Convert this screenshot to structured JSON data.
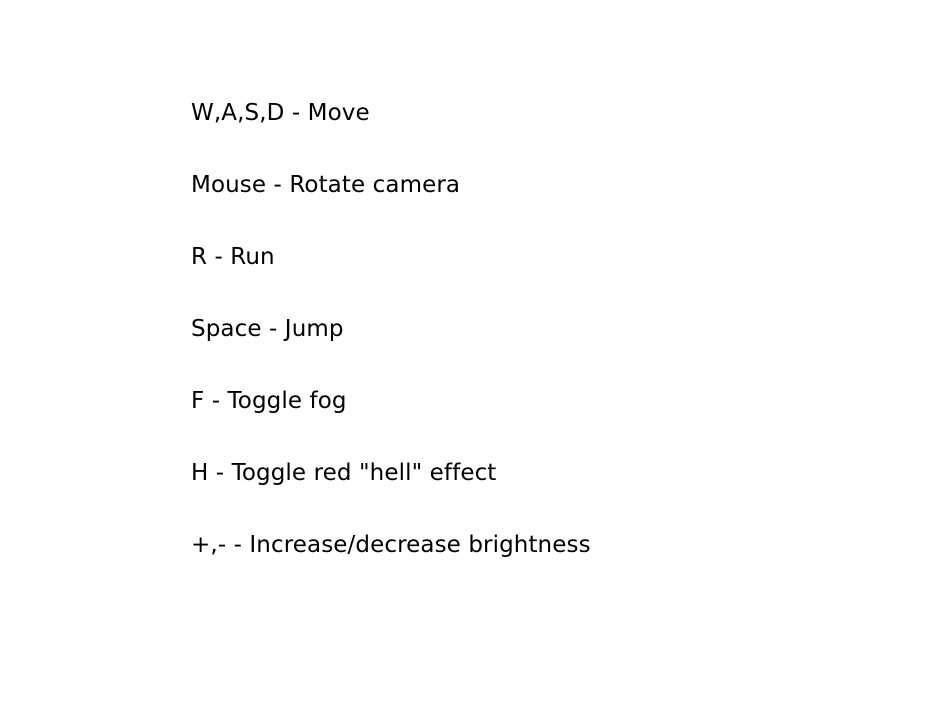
{
  "controls": [
    "W,A,S,D - Move",
    "Mouse - Rotate camera",
    "R - Run",
    "Space - Jump",
    "F - Toggle fog",
    "H - Toggle red \"hell\" effect",
    "+,- - Increase/decrease brightness"
  ]
}
